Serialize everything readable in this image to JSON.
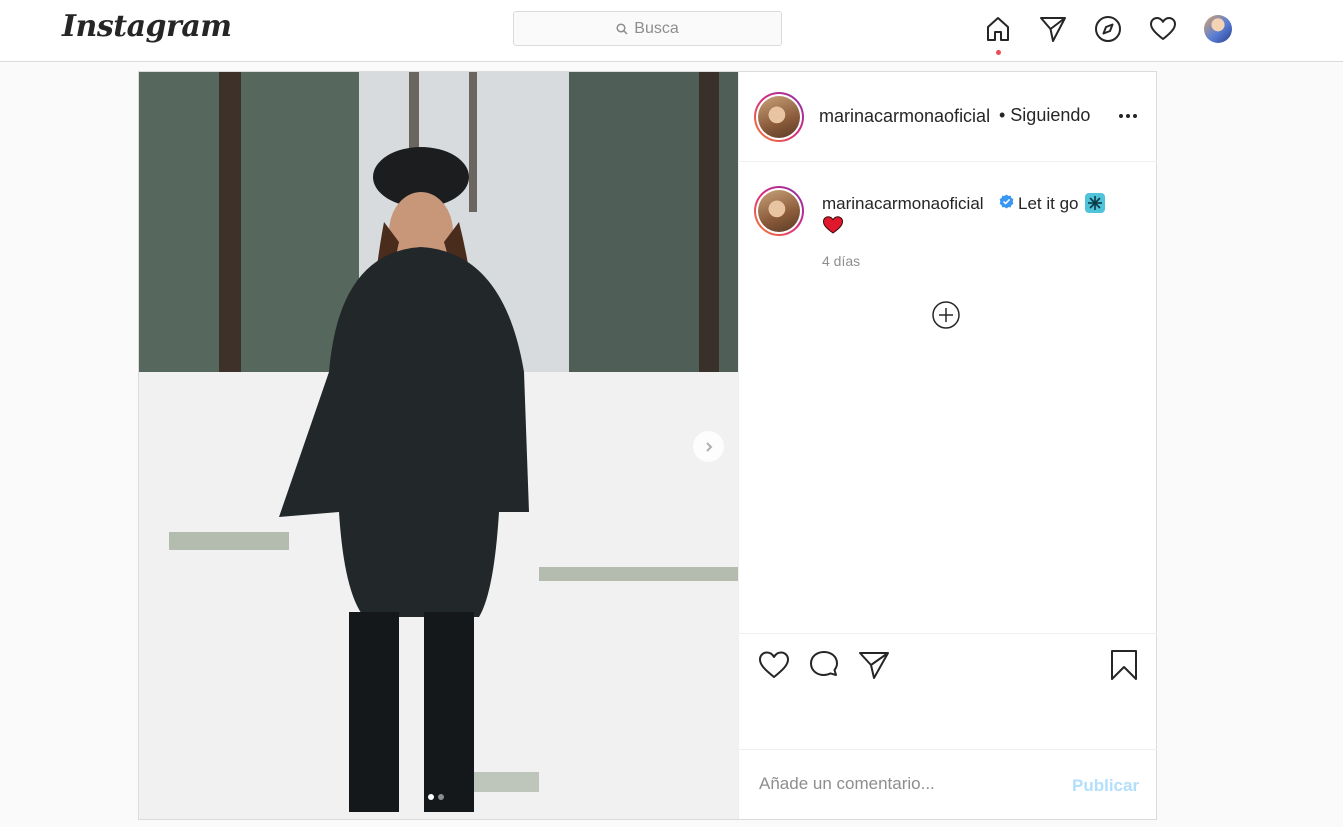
{
  "nav": {
    "logo": "Instagram",
    "search_placeholder": "Busca",
    "icons": [
      "home-icon",
      "direct-icon",
      "explore-icon",
      "activity-icon",
      "profile-avatar"
    ]
  },
  "post": {
    "username": "marinacarmonaoficial",
    "follow_status": "• Siguiendo",
    "caption_user": "marinacarmonaoficial",
    "caption_text": "Let it go",
    "caption_emojis": [
      "snowflake",
      "red-heart"
    ],
    "age": "4 días",
    "carousel": {
      "current": 1,
      "total": 2
    },
    "comment_placeholder": "Añade un comentario...",
    "publish_label": "Publicar"
  },
  "colors": {
    "accent_dot": "#ed4956",
    "publish_disabled": "#b2dffc",
    "verified": "#3897f0",
    "border": "#dbdbdb"
  }
}
